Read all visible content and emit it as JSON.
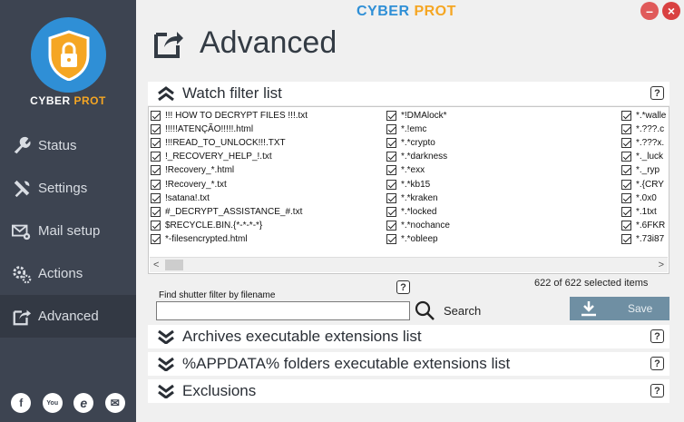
{
  "app": {
    "title_white": "CYBER ",
    "title_orange": "PROT"
  },
  "window": {
    "minimize_label": "–",
    "close_label": "×"
  },
  "brand": {
    "white": "CYBER ",
    "orange": "PROT"
  },
  "nav": {
    "items": [
      {
        "label": "Status",
        "icon": "wrench-icon"
      },
      {
        "label": "Settings",
        "icon": "tools-icon"
      },
      {
        "label": "Mail setup",
        "icon": "mail-gear-icon"
      },
      {
        "label": "Actions",
        "icon": "gears-icon"
      },
      {
        "label": "Advanced",
        "icon": "edit-arrow-icon"
      }
    ]
  },
  "social": {
    "facebook": "f",
    "youtube": "You",
    "web": "e",
    "mail": "✉"
  },
  "page": {
    "title": "Advanced"
  },
  "watch": {
    "title": "Watch filter list",
    "help": "?",
    "col1": [
      "!!! HOW TO DECRYPT FILES !!!.txt",
      "!!!!!ATENÇÃO!!!!!.html",
      "!!!READ_TO_UNLOCK!!!.TXT",
      "!_RECOVERY_HELP_!.txt",
      "!Recovery_*.html",
      "!Recovery_*.txt",
      "!satana!.txt",
      "#_DECRYPT_ASSISTANCE_#.txt",
      "$RECYCLE.BIN.{*-*-*-*}",
      "*-filesencrypted.html"
    ],
    "col2": [
      "*!DMAlock*",
      "*.!emc",
      "*.*crypto",
      "*.*darkness",
      "*.*exx",
      "*.*kb15",
      "*.*kraken",
      "*.*locked",
      "*.*nochance",
      "*.*obleep"
    ],
    "col3": [
      "*.*walle",
      "*.???.c",
      "*.???x.",
      "*._luck",
      "*._ryp",
      "*.{CRY",
      "*.0x0",
      "*.1txt",
      "*.6FKR",
      "*.73i87"
    ],
    "count_text": "622 of 622 selected items"
  },
  "find": {
    "label": "Find shutter filter by filename",
    "value": "",
    "search_label": "Search",
    "help": "?"
  },
  "save": {
    "label": "Save"
  },
  "sections": [
    {
      "title": "Archives executable extensions list",
      "help": "?"
    },
    {
      "title": "%APPDATA% folders executable extensions list",
      "help": "?"
    },
    {
      "title": "Exclusions",
      "help": "?"
    }
  ],
  "colors": {
    "sidebar": "#3d4451",
    "accent_blue": "#2f8fd6",
    "accent_orange": "#f5a623",
    "save_button": "#6f8fa3"
  }
}
